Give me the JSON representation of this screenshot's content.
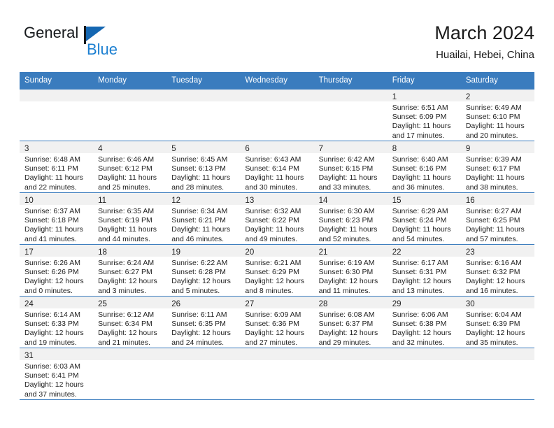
{
  "brand": {
    "name_primary": "General",
    "name_secondary": "Blue",
    "flag_color": "#1567b2",
    "secondary_color": "#1b7fd1"
  },
  "header": {
    "title": "March 2024",
    "subtitle": "Huailai, Hebei, China"
  },
  "theme": {
    "header_bg": "#3a7cbe",
    "daynum_bg": "#f1f1f1",
    "grid_line": "#3a7cbe",
    "text": "#222222"
  },
  "weekday_headers": [
    "Sunday",
    "Monday",
    "Tuesday",
    "Wednesday",
    "Thursday",
    "Friday",
    "Saturday"
  ],
  "weeks": [
    [
      {
        "day": "",
        "empty": true,
        "sunrise": "",
        "sunset": "",
        "daylight_line1": "",
        "daylight_line2": ""
      },
      {
        "day": "",
        "empty": true,
        "sunrise": "",
        "sunset": "",
        "daylight_line1": "",
        "daylight_line2": ""
      },
      {
        "day": "",
        "empty": true,
        "sunrise": "",
        "sunset": "",
        "daylight_line1": "",
        "daylight_line2": ""
      },
      {
        "day": "",
        "empty": true,
        "sunrise": "",
        "sunset": "",
        "daylight_line1": "",
        "daylight_line2": ""
      },
      {
        "day": "",
        "empty": true,
        "sunrise": "",
        "sunset": "",
        "daylight_line1": "",
        "daylight_line2": ""
      },
      {
        "day": "1",
        "empty": false,
        "sunrise": "Sunrise: 6:51 AM",
        "sunset": "Sunset: 6:09 PM",
        "daylight_line1": "Daylight: 11 hours",
        "daylight_line2": "and 17 minutes."
      },
      {
        "day": "2",
        "empty": false,
        "sunrise": "Sunrise: 6:49 AM",
        "sunset": "Sunset: 6:10 PM",
        "daylight_line1": "Daylight: 11 hours",
        "daylight_line2": "and 20 minutes."
      }
    ],
    [
      {
        "day": "3",
        "empty": false,
        "sunrise": "Sunrise: 6:48 AM",
        "sunset": "Sunset: 6:11 PM",
        "daylight_line1": "Daylight: 11 hours",
        "daylight_line2": "and 22 minutes."
      },
      {
        "day": "4",
        "empty": false,
        "sunrise": "Sunrise: 6:46 AM",
        "sunset": "Sunset: 6:12 PM",
        "daylight_line1": "Daylight: 11 hours",
        "daylight_line2": "and 25 minutes."
      },
      {
        "day": "5",
        "empty": false,
        "sunrise": "Sunrise: 6:45 AM",
        "sunset": "Sunset: 6:13 PM",
        "daylight_line1": "Daylight: 11 hours",
        "daylight_line2": "and 28 minutes."
      },
      {
        "day": "6",
        "empty": false,
        "sunrise": "Sunrise: 6:43 AM",
        "sunset": "Sunset: 6:14 PM",
        "daylight_line1": "Daylight: 11 hours",
        "daylight_line2": "and 30 minutes."
      },
      {
        "day": "7",
        "empty": false,
        "sunrise": "Sunrise: 6:42 AM",
        "sunset": "Sunset: 6:15 PM",
        "daylight_line1": "Daylight: 11 hours",
        "daylight_line2": "and 33 minutes."
      },
      {
        "day": "8",
        "empty": false,
        "sunrise": "Sunrise: 6:40 AM",
        "sunset": "Sunset: 6:16 PM",
        "daylight_line1": "Daylight: 11 hours",
        "daylight_line2": "and 36 minutes."
      },
      {
        "day": "9",
        "empty": false,
        "sunrise": "Sunrise: 6:39 AM",
        "sunset": "Sunset: 6:17 PM",
        "daylight_line1": "Daylight: 11 hours",
        "daylight_line2": "and 38 minutes."
      }
    ],
    [
      {
        "day": "10",
        "empty": false,
        "sunrise": "Sunrise: 6:37 AM",
        "sunset": "Sunset: 6:18 PM",
        "daylight_line1": "Daylight: 11 hours",
        "daylight_line2": "and 41 minutes."
      },
      {
        "day": "11",
        "empty": false,
        "sunrise": "Sunrise: 6:35 AM",
        "sunset": "Sunset: 6:19 PM",
        "daylight_line1": "Daylight: 11 hours",
        "daylight_line2": "and 44 minutes."
      },
      {
        "day": "12",
        "empty": false,
        "sunrise": "Sunrise: 6:34 AM",
        "sunset": "Sunset: 6:21 PM",
        "daylight_line1": "Daylight: 11 hours",
        "daylight_line2": "and 46 minutes."
      },
      {
        "day": "13",
        "empty": false,
        "sunrise": "Sunrise: 6:32 AM",
        "sunset": "Sunset: 6:22 PM",
        "daylight_line1": "Daylight: 11 hours",
        "daylight_line2": "and 49 minutes."
      },
      {
        "day": "14",
        "empty": false,
        "sunrise": "Sunrise: 6:30 AM",
        "sunset": "Sunset: 6:23 PM",
        "daylight_line1": "Daylight: 11 hours",
        "daylight_line2": "and 52 minutes."
      },
      {
        "day": "15",
        "empty": false,
        "sunrise": "Sunrise: 6:29 AM",
        "sunset": "Sunset: 6:24 PM",
        "daylight_line1": "Daylight: 11 hours",
        "daylight_line2": "and 54 minutes."
      },
      {
        "day": "16",
        "empty": false,
        "sunrise": "Sunrise: 6:27 AM",
        "sunset": "Sunset: 6:25 PM",
        "daylight_line1": "Daylight: 11 hours",
        "daylight_line2": "and 57 minutes."
      }
    ],
    [
      {
        "day": "17",
        "empty": false,
        "sunrise": "Sunrise: 6:26 AM",
        "sunset": "Sunset: 6:26 PM",
        "daylight_line1": "Daylight: 12 hours",
        "daylight_line2": "and 0 minutes."
      },
      {
        "day": "18",
        "empty": false,
        "sunrise": "Sunrise: 6:24 AM",
        "sunset": "Sunset: 6:27 PM",
        "daylight_line1": "Daylight: 12 hours",
        "daylight_line2": "and 3 minutes."
      },
      {
        "day": "19",
        "empty": false,
        "sunrise": "Sunrise: 6:22 AM",
        "sunset": "Sunset: 6:28 PM",
        "daylight_line1": "Daylight: 12 hours",
        "daylight_line2": "and 5 minutes."
      },
      {
        "day": "20",
        "empty": false,
        "sunrise": "Sunrise: 6:21 AM",
        "sunset": "Sunset: 6:29 PM",
        "daylight_line1": "Daylight: 12 hours",
        "daylight_line2": "and 8 minutes."
      },
      {
        "day": "21",
        "empty": false,
        "sunrise": "Sunrise: 6:19 AM",
        "sunset": "Sunset: 6:30 PM",
        "daylight_line1": "Daylight: 12 hours",
        "daylight_line2": "and 11 minutes."
      },
      {
        "day": "22",
        "empty": false,
        "sunrise": "Sunrise: 6:17 AM",
        "sunset": "Sunset: 6:31 PM",
        "daylight_line1": "Daylight: 12 hours",
        "daylight_line2": "and 13 minutes."
      },
      {
        "day": "23",
        "empty": false,
        "sunrise": "Sunrise: 6:16 AM",
        "sunset": "Sunset: 6:32 PM",
        "daylight_line1": "Daylight: 12 hours",
        "daylight_line2": "and 16 minutes."
      }
    ],
    [
      {
        "day": "24",
        "empty": false,
        "sunrise": "Sunrise: 6:14 AM",
        "sunset": "Sunset: 6:33 PM",
        "daylight_line1": "Daylight: 12 hours",
        "daylight_line2": "and 19 minutes."
      },
      {
        "day": "25",
        "empty": false,
        "sunrise": "Sunrise: 6:12 AM",
        "sunset": "Sunset: 6:34 PM",
        "daylight_line1": "Daylight: 12 hours",
        "daylight_line2": "and 21 minutes."
      },
      {
        "day": "26",
        "empty": false,
        "sunrise": "Sunrise: 6:11 AM",
        "sunset": "Sunset: 6:35 PM",
        "daylight_line1": "Daylight: 12 hours",
        "daylight_line2": "and 24 minutes."
      },
      {
        "day": "27",
        "empty": false,
        "sunrise": "Sunrise: 6:09 AM",
        "sunset": "Sunset: 6:36 PM",
        "daylight_line1": "Daylight: 12 hours",
        "daylight_line2": "and 27 minutes."
      },
      {
        "day": "28",
        "empty": false,
        "sunrise": "Sunrise: 6:08 AM",
        "sunset": "Sunset: 6:37 PM",
        "daylight_line1": "Daylight: 12 hours",
        "daylight_line2": "and 29 minutes."
      },
      {
        "day": "29",
        "empty": false,
        "sunrise": "Sunrise: 6:06 AM",
        "sunset": "Sunset: 6:38 PM",
        "daylight_line1": "Daylight: 12 hours",
        "daylight_line2": "and 32 minutes."
      },
      {
        "day": "30",
        "empty": false,
        "sunrise": "Sunrise: 6:04 AM",
        "sunset": "Sunset: 6:39 PM",
        "daylight_line1": "Daylight: 12 hours",
        "daylight_line2": "and 35 minutes."
      }
    ],
    [
      {
        "day": "31",
        "empty": false,
        "sunrise": "Sunrise: 6:03 AM",
        "sunset": "Sunset: 6:41 PM",
        "daylight_line1": "Daylight: 12 hours",
        "daylight_line2": "and 37 minutes."
      },
      {
        "day": "",
        "empty": true,
        "sunrise": "",
        "sunset": "",
        "daylight_line1": "",
        "daylight_line2": ""
      },
      {
        "day": "",
        "empty": true,
        "sunrise": "",
        "sunset": "",
        "daylight_line1": "",
        "daylight_line2": ""
      },
      {
        "day": "",
        "empty": true,
        "sunrise": "",
        "sunset": "",
        "daylight_line1": "",
        "daylight_line2": ""
      },
      {
        "day": "",
        "empty": true,
        "sunrise": "",
        "sunset": "",
        "daylight_line1": "",
        "daylight_line2": ""
      },
      {
        "day": "",
        "empty": true,
        "sunrise": "",
        "sunset": "",
        "daylight_line1": "",
        "daylight_line2": ""
      },
      {
        "day": "",
        "empty": true,
        "sunrise": "",
        "sunset": "",
        "daylight_line1": "",
        "daylight_line2": ""
      }
    ]
  ]
}
